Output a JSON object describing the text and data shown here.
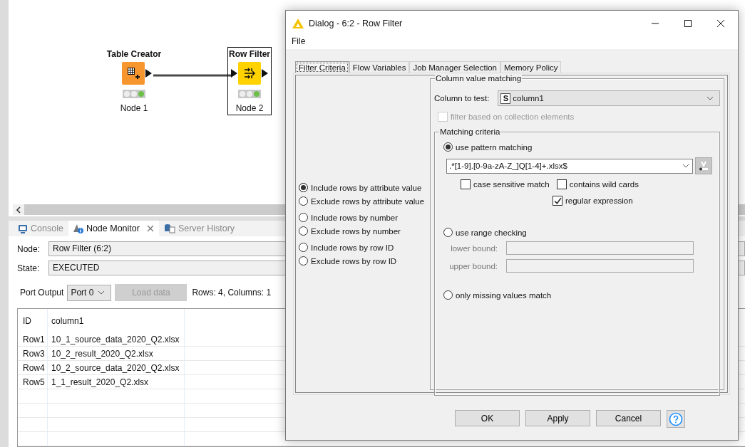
{
  "workflow": {
    "nodes": [
      {
        "title": "Table Creator",
        "label": "Node 1",
        "kind": "source",
        "selected": false
      },
      {
        "title": "Row Filter",
        "label": "Node 2",
        "kind": "filter",
        "selected": true
      }
    ]
  },
  "panel": {
    "tabs": [
      {
        "label": "Console",
        "kind": "console",
        "selected": false
      },
      {
        "label": "Node Monitor",
        "kind": "monitor",
        "selected": true
      },
      {
        "label": "Server History",
        "kind": "history",
        "selected": false
      }
    ],
    "node_label": "Node:",
    "node_value": "Row Filter  (6:2)",
    "state_label": "State:",
    "state_value": "EXECUTED",
    "port_label": "Port Output",
    "port_value": "Port 0",
    "load_button": {
      "label": "Load data",
      "disabled": true
    },
    "summary": "Rows: 4, Columns: 1",
    "table": {
      "columns": [
        "ID",
        "column1"
      ],
      "rows": [
        [
          "Row1",
          "10_1_source_data_2020_Q2.xlsx"
        ],
        [
          "Row3",
          "10_2_result_2020_Q2.xlsx"
        ],
        [
          "Row4",
          "10_2_source_data_2020_Q2.xlsx"
        ],
        [
          "Row5",
          "1_1_result_2020_Q2.xlsx"
        ]
      ]
    }
  },
  "dialog": {
    "title": "Dialog - 6:2 - Row Filter",
    "menu": [
      "File"
    ],
    "tabs": [
      {
        "label": "Filter Criteria",
        "selected": true
      },
      {
        "label": "Flow Variables",
        "selected": false
      },
      {
        "label": "Job Manager Selection",
        "selected": false
      },
      {
        "label": "Memory Policy",
        "selected": false
      }
    ],
    "modes": [
      {
        "label": "Include rows by attribute value",
        "selected": true
      },
      {
        "label": "Exclude rows by attribute value",
        "selected": false
      },
      {
        "label": "Include rows by number",
        "selected": false
      },
      {
        "label": "Exclude rows by number",
        "selected": false
      },
      {
        "label": "Include rows by row ID",
        "selected": false
      },
      {
        "label": "Exclude rows by row ID",
        "selected": false
      }
    ],
    "group_title": "Column value matching",
    "column_label": "Column to test:",
    "column_type": "S",
    "column_value": "column1",
    "collection_filter": {
      "label": "filter based on collection elements",
      "checked": false,
      "disabled": true
    },
    "matching_title": "Matching criteria",
    "pattern": {
      "label": "use pattern matching",
      "selected": true,
      "value": ".*[1-9].[0-9a-zA-Z_]Q[1-4]+.xlsx$",
      "options": [
        {
          "label": "case sensitive match",
          "checked": false
        },
        {
          "label": "contains wild cards",
          "checked": false
        },
        {
          "label": "regular expression",
          "checked": true
        }
      ]
    },
    "range": {
      "label": "use range checking",
      "selected": false,
      "lower_label": "lower bound:",
      "upper_label": "upper bound:"
    },
    "missing": {
      "label": "only missing values match",
      "selected": false
    },
    "buttons": [
      "OK",
      "Apply",
      "Cancel"
    ]
  }
}
